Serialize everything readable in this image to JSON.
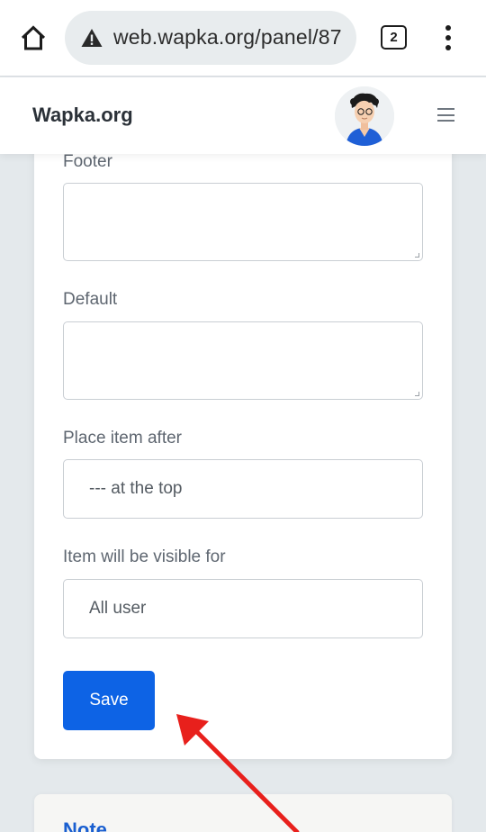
{
  "browser": {
    "url": "web.wapka.org/panel/87",
    "tab_count": "2",
    "icons": {
      "home": "home-icon",
      "warning": "warning-icon",
      "menu": "more-vert-icon"
    }
  },
  "header": {
    "brand": "Wapka.org",
    "menu_icon": "hamburger-icon"
  },
  "form": {
    "footer_label": "Footer",
    "footer_value": "",
    "default_label": "Default",
    "default_value": "",
    "place_after_label": "Place item after",
    "place_after_value": "--- at the top",
    "visible_for_label": "Item will be visible for",
    "visible_for_value": "All user",
    "save_label": "Save"
  },
  "note": {
    "title": "Note"
  },
  "colors": {
    "accent": "#0d63e5",
    "annotation_arrow": "#e8201c"
  }
}
